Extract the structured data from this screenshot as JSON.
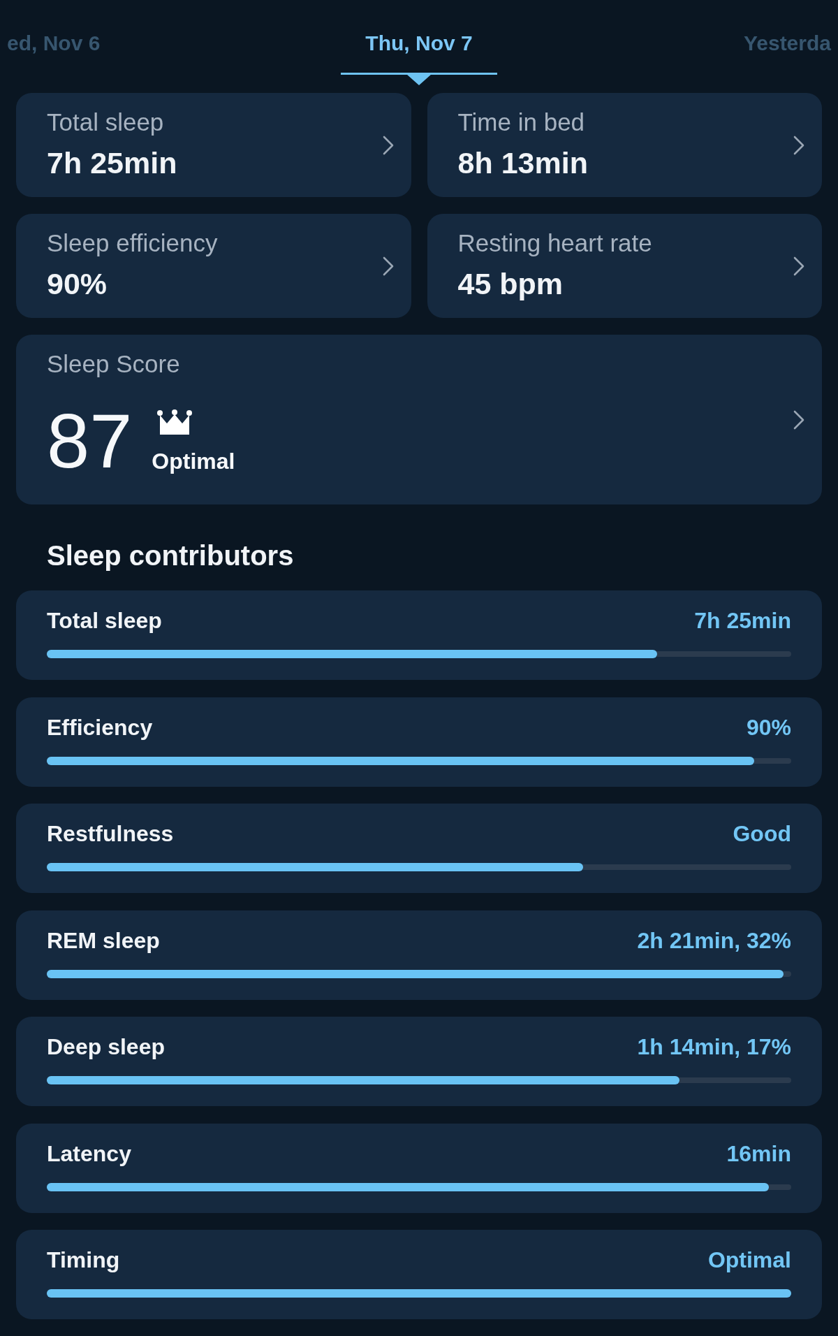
{
  "date_tabs": [
    {
      "label": "ed, Nov 6",
      "selected": false
    },
    {
      "label": "Thu, Nov 7",
      "selected": true
    },
    {
      "label": "Yesterda",
      "selected": false
    }
  ],
  "metrics": [
    {
      "label": "Total sleep",
      "value": "7h 25min"
    },
    {
      "label": "Time in bed",
      "value": "8h 13min"
    },
    {
      "label": "Sleep efficiency",
      "value": "90%"
    },
    {
      "label": "Resting heart rate",
      "value": "45 bpm"
    }
  ],
  "sleep_score": {
    "label": "Sleep Score",
    "score": "87",
    "rating": "Optimal"
  },
  "contributors_heading": "Sleep contributors",
  "contributors": [
    {
      "label": "Total sleep",
      "value": "7h 25min",
      "level": 0.82
    },
    {
      "label": "Efficiency",
      "value": "90%",
      "level": 0.95
    },
    {
      "label": "Restfulness",
      "value": "Good",
      "level": 0.72
    },
    {
      "label": "REM sleep",
      "value": "2h 21min, 32%",
      "level": 0.99
    },
    {
      "label": "Deep sleep",
      "value": "1h 14min, 17%",
      "level": 0.85
    },
    {
      "label": "Latency",
      "value": "16min",
      "level": 0.97
    },
    {
      "label": "Timing",
      "value": "Optimal",
      "level": 1.0
    }
  ]
}
